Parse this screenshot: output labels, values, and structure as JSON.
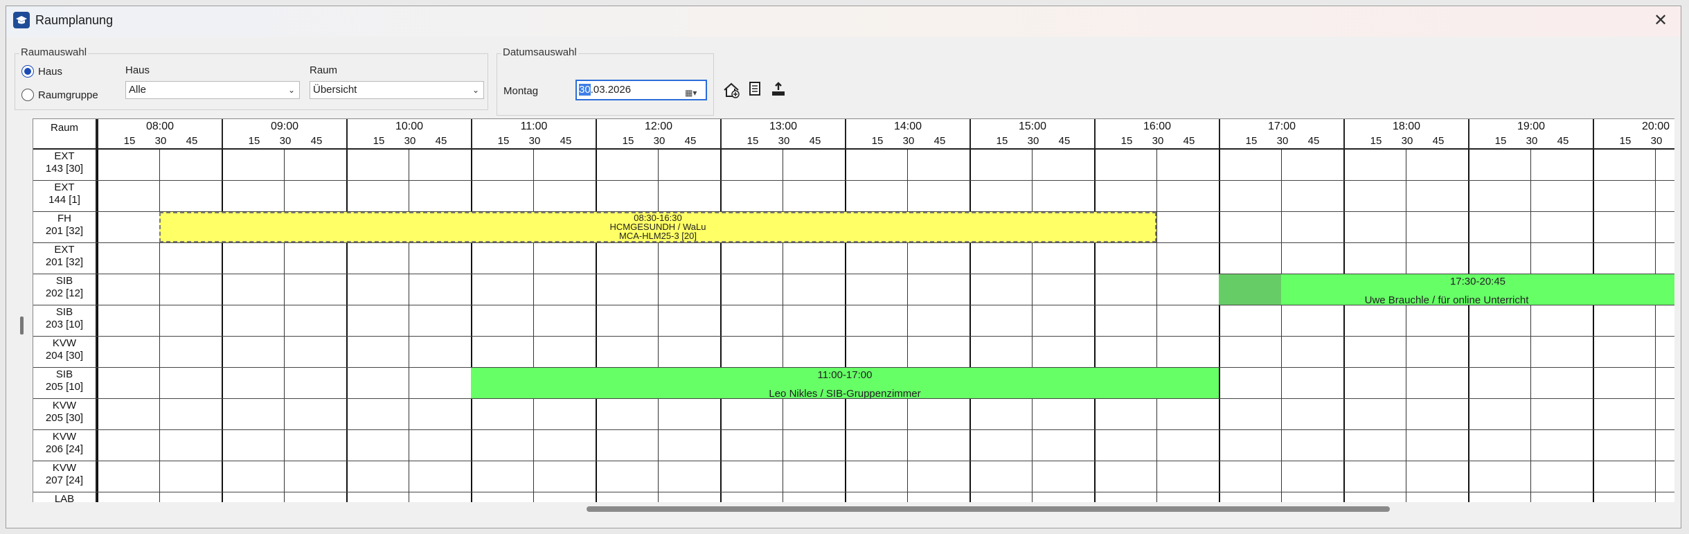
{
  "window": {
    "title": "Raumplanung",
    "close": "✕"
  },
  "raumauswahl": {
    "title": "Raumauswahl",
    "opt_haus": "Haus",
    "opt_raumgruppe": "Raumgruppe",
    "haus_label": "Haus",
    "haus_value": "Alle",
    "raum_label": "Raum",
    "raum_value": "Übersicht"
  },
  "datumsauswahl": {
    "title": "Datumsauswahl",
    "weekday": "Montag",
    "date_day": "30",
    "date_rest": ".03.2026"
  },
  "toolbar": {
    "icons": [
      "house-add-icon",
      "list-icon",
      "export-icon"
    ]
  },
  "grid": {
    "room_header": "Raum",
    "hours": [
      "08:00",
      "09:00",
      "10:00",
      "11:00",
      "12:00",
      "13:00",
      "14:00",
      "15:00",
      "16:00",
      "17:00",
      "18:00",
      "19:00",
      "20:00"
    ],
    "quarters": [
      "15",
      "30",
      "45"
    ],
    "rooms": [
      {
        "l1": "EXT",
        "l2": "143 [30]"
      },
      {
        "l1": "EXT",
        "l2": "144 [1]"
      },
      {
        "l1": "FH",
        "l2": "201 [32]"
      },
      {
        "l1": "EXT",
        "l2": "201 [32]"
      },
      {
        "l1": "SIB",
        "l2": "202 [12]"
      },
      {
        "l1": "SIB",
        "l2": "203 [10]"
      },
      {
        "l1": "KVW",
        "l2": "204 [30]"
      },
      {
        "l1": "SIB",
        "l2": "205 [10]"
      },
      {
        "l1": "KVW",
        "l2": "205 [30]"
      },
      {
        "l1": "KVW",
        "l2": "206 [24]"
      },
      {
        "l1": "KVW",
        "l2": "207 [24]"
      },
      {
        "l1": "LAB",
        "l2": ""
      }
    ],
    "bookings": [
      {
        "row": 2,
        "start": "08:30",
        "end": "16:30",
        "style": "yellow",
        "lines": [
          "08:30-16:30",
          "HCMGESUNDH / WaLu",
          "MCA-HLM25-3 [20]"
        ]
      },
      {
        "row": 4,
        "start": "17:30",
        "end": "20:45",
        "style": "green",
        "pre_start": "17:00",
        "lines": [
          "17:30-20:45",
          "Uwe Brauchle  / für online Unterricht"
        ]
      },
      {
        "row": 7,
        "start": "11:00",
        "end": "17:00",
        "style": "green",
        "lines": [
          "11:00-17:00",
          "Leo Nikles / SIB-Gruppenzimmer"
        ]
      }
    ]
  },
  "colors": {
    "yellow": "#ffff66",
    "green": "#66ff66",
    "green_pre": "#66cc66",
    "accent": "#2b6cd9"
  }
}
